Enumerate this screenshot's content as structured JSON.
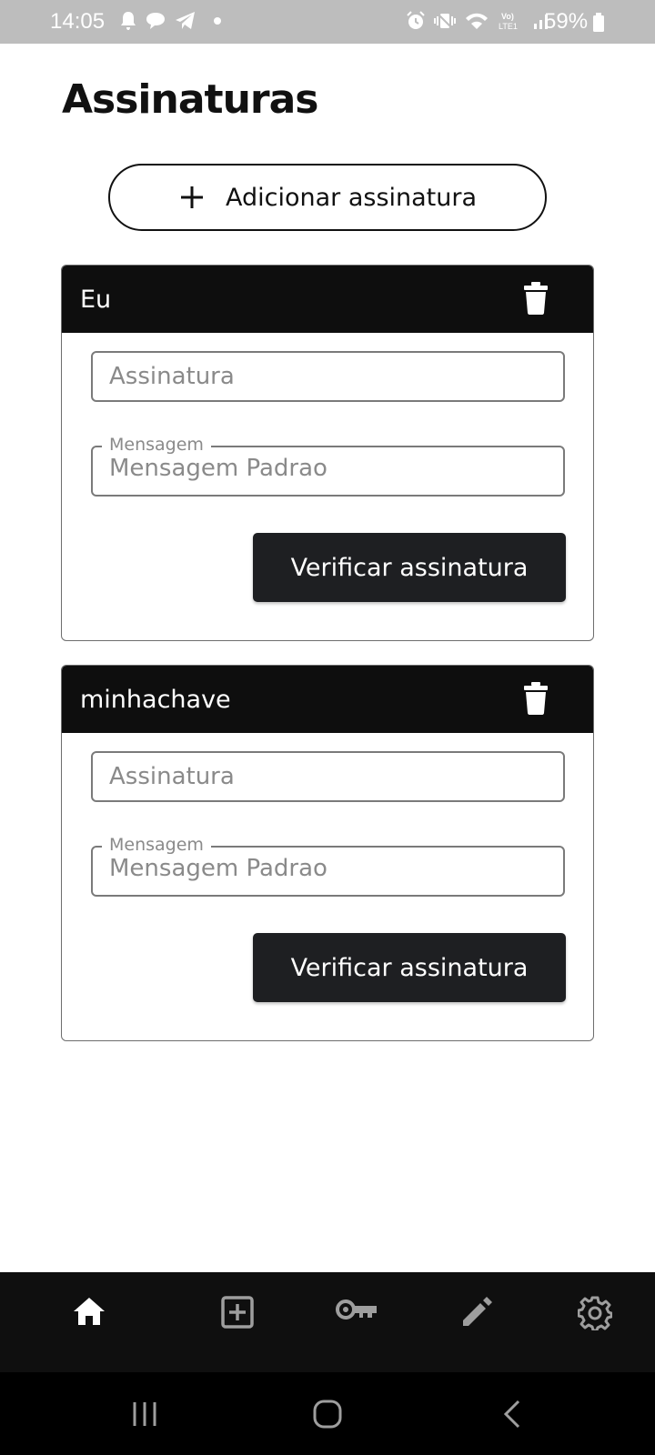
{
  "status_bar": {
    "time": "14:05",
    "battery": "59%",
    "left_icons": [
      "notification-bell-icon",
      "chat-bubble-icon",
      "telegram-icon",
      "dot-icon"
    ],
    "right_icons": [
      "alarm-icon",
      "vibrate-icon",
      "wifi-icon",
      "volte-icon",
      "signal-icon",
      "battery-icon"
    ]
  },
  "header": {
    "title": "Assinaturas"
  },
  "add_button": {
    "label": "Adicionar assinatura",
    "icon": "plus-icon"
  },
  "cards": [
    {
      "name": "Eu",
      "signature_placeholder": "Assinatura",
      "message_label": "Mensagem",
      "message_value": "Mensagem Padrao",
      "verify_label": "Verificar assinatura"
    },
    {
      "name": "minhachave",
      "signature_placeholder": "Assinatura",
      "message_label": "Mensagem",
      "message_value": "Mensagem Padrao",
      "verify_label": "Verificar assinatura"
    }
  ],
  "bottom_nav": {
    "items": [
      "home-icon",
      "add-box-icon",
      "key-icon",
      "pencil-icon",
      "settings-gear-icon"
    ],
    "active": "home-icon"
  },
  "system_nav": [
    "recent-apps-icon",
    "home-button-icon",
    "back-icon"
  ],
  "colors": {
    "status_bar": "#bdbdbd",
    "card_header": "#0e0e0e",
    "verify_button": "#1e1f22",
    "bottom_nav": "#0f0f0f",
    "nav_active": "#ffffff",
    "nav_inactive": "#9e9e9e"
  }
}
